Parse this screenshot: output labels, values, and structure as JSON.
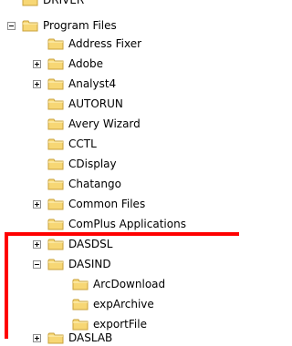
{
  "tree": {
    "partial_top_label": "DRIVER",
    "program_files": "Program Files",
    "children": [
      {
        "label": "Address Fixer",
        "expander": "none"
      },
      {
        "label": "Adobe",
        "expander": "plus"
      },
      {
        "label": "Analyst4",
        "expander": "plus"
      },
      {
        "label": "AUTORUN",
        "expander": "none"
      },
      {
        "label": "Avery Wizard",
        "expander": "none"
      },
      {
        "label": "CCTL",
        "expander": "none"
      },
      {
        "label": "CDisplay",
        "expander": "none"
      },
      {
        "label": "Chatango",
        "expander": "none"
      },
      {
        "label": "Common Files",
        "expander": "plus"
      },
      {
        "label": "ComPlus Applications",
        "expander": "none"
      },
      {
        "label": "DASDSL",
        "expander": "plus"
      },
      {
        "label": "DASIND",
        "expander": "minus"
      },
      {
        "label": "DASLAB",
        "expander": "plus"
      }
    ],
    "dasind_children": [
      "ArcDownload",
      "expArchive",
      "exportFile"
    ]
  },
  "colors": {
    "folder_fill": "#f7d775",
    "folder_edge": "#c9a23a",
    "highlight_box": "#ff0000"
  },
  "icons": {
    "folder": "folder-icon",
    "expand": "plus-box-icon",
    "collapse": "minus-box-icon"
  }
}
